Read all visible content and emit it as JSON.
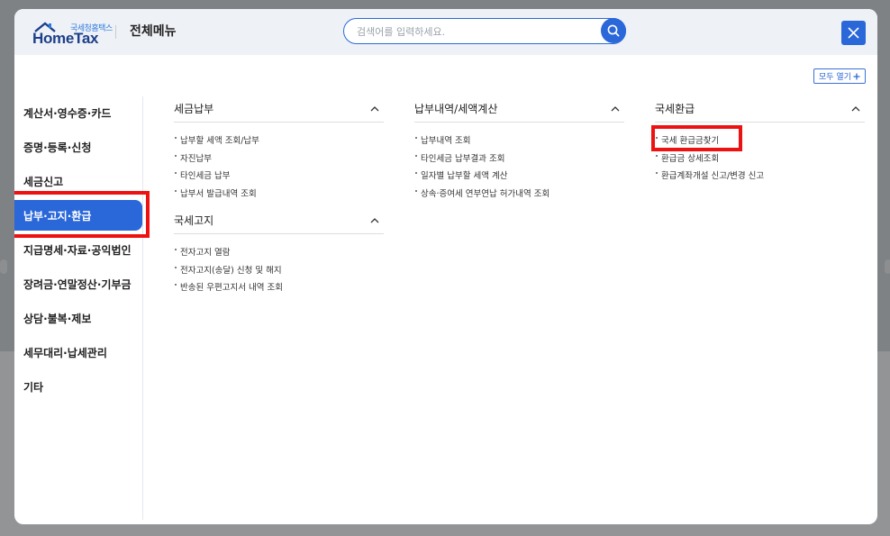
{
  "header": {
    "logo_small": "국세청홈택스",
    "logo_main": "HomeTax",
    "title": "전체메뉴",
    "search_placeholder": "검색어를 입력하세요."
  },
  "expand_all_label": "모두 열기",
  "left_nav": {
    "items": [
      {
        "label": "계산서·영수증·카드"
      },
      {
        "label": "증명·등록·신청"
      },
      {
        "label": "세금신고"
      },
      {
        "label": "납부·고지·환급"
      },
      {
        "label": "지급명세·자료·공익법인"
      },
      {
        "label": "장려금·연말정산·기부금"
      },
      {
        "label": "상담·불복·제보"
      },
      {
        "label": "세무대리·납세관리"
      },
      {
        "label": "기타"
      }
    ],
    "active_index": 3
  },
  "columns": [
    {
      "sections": [
        {
          "title": "세금납부",
          "items": [
            "납부할 세액 조회/납부",
            "자진납부",
            "타인세금 납부",
            "납부서 발급내역 조회"
          ]
        },
        {
          "title": "국세고지",
          "items": [
            "전자고지 열람",
            "전자고지(송달) 신청 및 해지",
            "반송된 우편고지서 내역 조회"
          ]
        }
      ]
    },
    {
      "sections": [
        {
          "title": "납부내역/세액계산",
          "items": [
            "납부내역 조회",
            "타인세금 납부결과 조회",
            "일자별 납부할 세액 계산",
            "상속·증여세 연부연납 허가내역 조회"
          ]
        }
      ]
    },
    {
      "sections": [
        {
          "title": "국세환급",
          "items": [
            "국세 환급금찾기",
            "환급금 상세조회",
            "환급계좌개설 신고/변경 신고"
          ]
        }
      ]
    }
  ],
  "colors": {
    "accent": "#2a67d9",
    "highlight": "#ee1111",
    "header_bg": "#eef1f6",
    "overlay": "#7f8284"
  },
  "icons": [
    "search-icon",
    "close-icon",
    "plus-icon",
    "chevron-up-icon"
  ]
}
